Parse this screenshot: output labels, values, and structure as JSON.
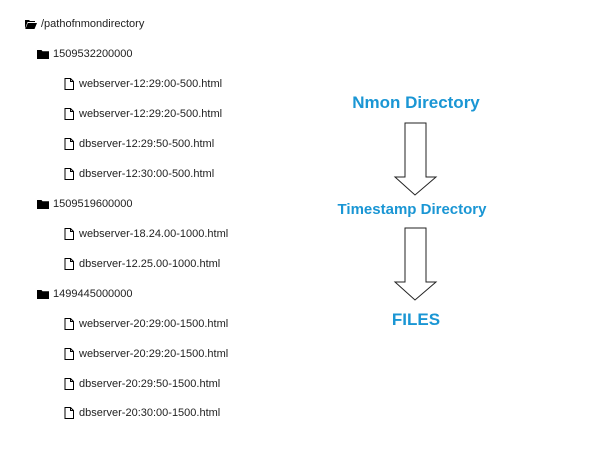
{
  "tree": {
    "root": {
      "label": "/pathofnmondirectory",
      "icon": "folder-open-icon"
    },
    "folders": [
      {
        "label": "1509532200000",
        "icon": "folder-icon",
        "files": [
          "webserver-12:29:00-500.html",
          "webserver-12:29:20-500.html",
          "dbserver-12:29:50-500.html",
          "dbserver-12:30:00-500.html"
        ]
      },
      {
        "label": "1509519600000",
        "icon": "folder-icon",
        "files": [
          "webserver-18.24.00-1000.html",
          "dbserver-12.25.00-1000.html"
        ]
      },
      {
        "label": "1499445000000",
        "icon": "folder-icon",
        "files": [
          "webserver-20:29:00-1500.html",
          "webserver-20:29:20-1500.html",
          "dbserver-20:29:50-1500.html",
          "dbserver-20:30:00-1500.html"
        ]
      }
    ],
    "file_icon": "file-icon"
  },
  "flow": {
    "nmon_directory": "Nmon Directory",
    "timestamp_directory": "Timestamp Directory",
    "files": "FILES",
    "arrow_icon": "down-arrow-icon",
    "accent_color": "#1a96d4"
  }
}
